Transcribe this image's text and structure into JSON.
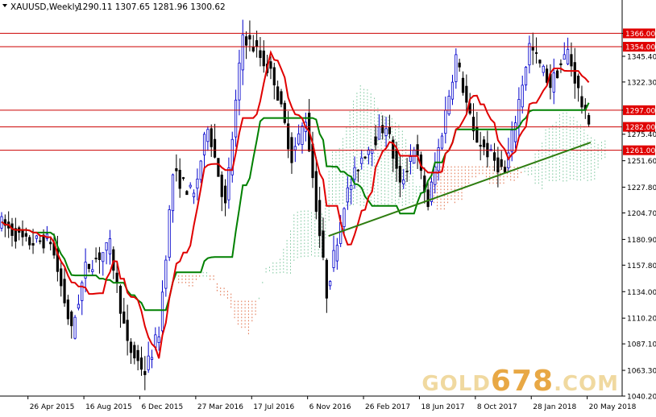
{
  "header": {
    "symbol": "XAUUSD,Weekly",
    "ohlc": "1290.11 1307.65 1281.96 1300.62"
  },
  "watermark": {
    "prefix": "GOLD",
    "number": "678",
    "suffix": ".COM"
  },
  "colors": {
    "bull": "#0000cc",
    "bear": "#000000",
    "tenkan": "#e00000",
    "kijun": "#008000",
    "cloud_bull": "#7fc8a0",
    "cloud_bear": "#e0704a",
    "level_line": "#cc0000",
    "trendline": "#2e7d10",
    "level_label_bg": "#e00000",
    "level_label_text": "#ffffff"
  },
  "chart_data": {
    "type": "line",
    "instrument": "XAUUSD",
    "timeframe": "Weekly",
    "ylim": [
      1040.2,
      1381.5
    ],
    "xlim": [
      "2015-03-01",
      "2018-07-29"
    ],
    "y_ticks": [
      1366.0,
      1345.4,
      1322.3,
      1297.0,
      1275.4,
      1251.6,
      1227.8,
      1204.7,
      1180.9,
      1157.8,
      1134.0,
      1110.2,
      1087.1,
      1063.3,
      1040.2
    ],
    "x_tick_labels": [
      {
        "date": "2015-04-26",
        "label": "26 Apr 2015"
      },
      {
        "date": "2015-08-16",
        "label": "16 Aug 2015"
      },
      {
        "date": "2015-12-06",
        "label": "6 Dec 2015"
      },
      {
        "date": "2016-03-27",
        "label": "27 Mar 2016"
      },
      {
        "date": "2016-07-17",
        "label": "17 Jul 2016"
      },
      {
        "date": "2016-11-06",
        "label": "6 Nov 2016"
      },
      {
        "date": "2017-02-26",
        "label": "26 Feb 2017"
      },
      {
        "date": "2017-06-18",
        "label": "18 Jun 2017"
      },
      {
        "date": "2017-10-08",
        "label": "8 Oct 2017"
      },
      {
        "date": "2018-01-28",
        "label": "28 Jan 2018"
      },
      {
        "date": "2018-05-20",
        "label": "20 May 2018"
      }
    ],
    "horizontal_levels": [
      {
        "value": 1366.0,
        "label": "1366.00"
      },
      {
        "value": 1354.0,
        "label": "1354.00"
      },
      {
        "value": 1297.0,
        "label": "1297.00"
      },
      {
        "value": 1282.0,
        "label": "1282.00"
      },
      {
        "value": 1261.0,
        "label": "1261.00"
      }
    ],
    "trendline": {
      "from": {
        "x": "2016-12-18",
        "y": 1184.0
      },
      "to": {
        "x": "2018-05-27",
        "y": 1268.0
      }
    },
    "price": [
      {
        "x": "2015-03-01",
        "y": 1198
      },
      {
        "x": "2015-04-26",
        "y": 1178
      },
      {
        "x": "2015-06-14",
        "y": 1180
      },
      {
        "x": "2015-07-26",
        "y": 1098
      },
      {
        "x": "2015-08-23",
        "y": 1155
      },
      {
        "x": "2015-10-11",
        "y": 1175
      },
      {
        "x": "2015-11-15",
        "y": 1085
      },
      {
        "x": "2015-12-20",
        "y": 1062
      },
      {
        "x": "2016-01-17",
        "y": 1098
      },
      {
        "x": "2016-02-14",
        "y": 1240
      },
      {
        "x": "2016-03-27",
        "y": 1220
      },
      {
        "x": "2016-04-24",
        "y": 1285
      },
      {
        "x": "2016-05-29",
        "y": 1210
      },
      {
        "x": "2016-07-03",
        "y": 1365
      },
      {
        "x": "2016-07-31",
        "y": 1350
      },
      {
        "x": "2016-09-04",
        "y": 1325
      },
      {
        "x": "2016-10-09",
        "y": 1255
      },
      {
        "x": "2016-11-06",
        "y": 1290
      },
      {
        "x": "2016-12-18",
        "y": 1133
      },
      {
        "x": "2017-01-22",
        "y": 1215
      },
      {
        "x": "2017-02-26",
        "y": 1255
      },
      {
        "x": "2017-04-16",
        "y": 1285
      },
      {
        "x": "2017-05-14",
        "y": 1228
      },
      {
        "x": "2017-06-11",
        "y": 1265
      },
      {
        "x": "2017-07-09",
        "y": 1212
      },
      {
        "x": "2017-09-03",
        "y": 1345
      },
      {
        "x": "2017-10-08",
        "y": 1275
      },
      {
        "x": "2017-12-10",
        "y": 1240
      },
      {
        "x": "2018-01-28",
        "y": 1355
      },
      {
        "x": "2018-03-11",
        "y": 1320
      },
      {
        "x": "2018-04-15",
        "y": 1350
      },
      {
        "x": "2018-05-20",
        "y": 1290
      }
    ]
  }
}
